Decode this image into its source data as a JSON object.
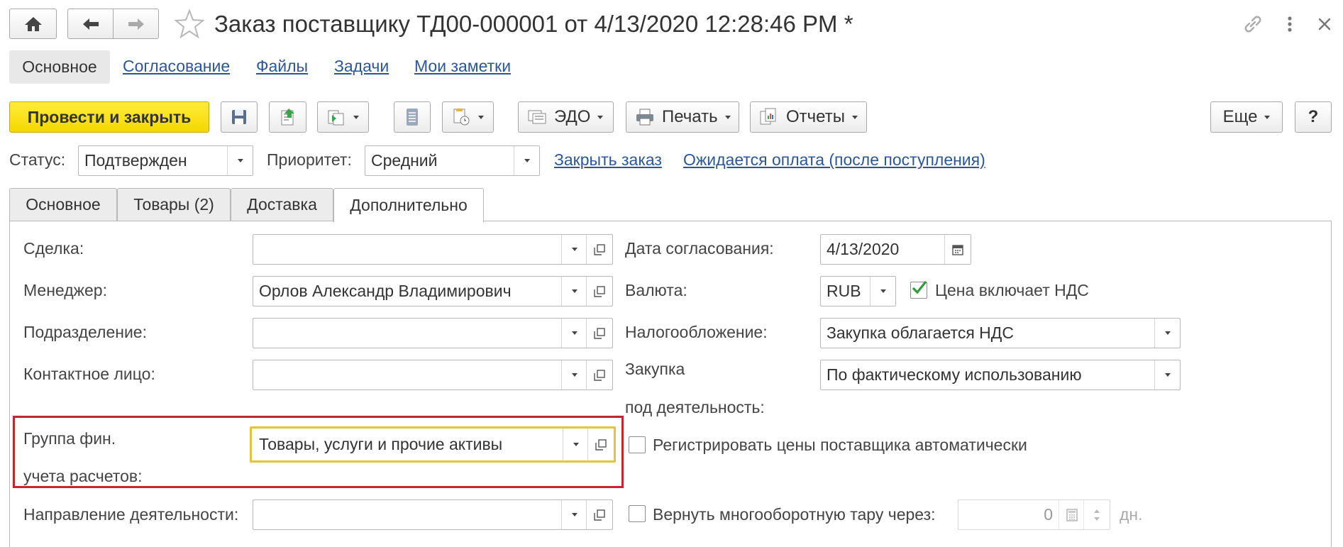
{
  "header": {
    "title": "Заказ поставщику ТД00-000001 от 4/13/2020 12:28:46 PM *"
  },
  "nav_tabs": [
    {
      "label": "Основное"
    },
    {
      "label": "Согласование"
    },
    {
      "label": "Файлы"
    },
    {
      "label": "Задачи"
    },
    {
      "label": "Мои заметки"
    }
  ],
  "toolbar": {
    "post_close": "Провести и закрыть",
    "edo": "ЭДО",
    "print": "Печать",
    "reports": "Отчеты",
    "more": "Еще",
    "help": "?"
  },
  "status_row": {
    "status_label": "Статус:",
    "status_value": "Подтвержден",
    "priority_label": "Приоритет:",
    "priority_value": "Средний",
    "close_order_link": "Закрыть заказ",
    "payment_link": "Ожидается оплата (после поступления)"
  },
  "form_tabs": [
    {
      "label": "Основное"
    },
    {
      "label": "Товары (2)"
    },
    {
      "label": "Доставка"
    },
    {
      "label": "Дополнительно"
    }
  ],
  "left_fields": {
    "deal_label": "Сделка:",
    "deal_value": "",
    "manager_label": "Менеджер:",
    "manager_value": "Орлов Александр Владимирович",
    "division_label": "Подразделение:",
    "division_value": "",
    "contact_label": "Контактное лицо:",
    "contact_value": "",
    "fin_group_label_1": "Группа фин.",
    "fin_group_label_2": "учета расчетов:",
    "fin_group_value": "Товары, услуги и прочие активы",
    "direction_label": "Направление деятельности:",
    "direction_value": ""
  },
  "right_fields": {
    "approval_date_label": "Дата согласования:",
    "approval_date_value": "4/13/2020",
    "currency_label": "Валюта:",
    "currency_value": "RUB",
    "vat_included_label": "Цена включает НДС",
    "vat_included_checked": true,
    "taxation_label": "Налогообложение:",
    "taxation_value": "Закупка облагается НДС",
    "purchase_label_1": "Закупка",
    "purchase_label_2": "под деятельность:",
    "purchase_value": "По фактическому использованию",
    "register_prices_label": "Регистрировать цены поставщика автоматически",
    "return_tare_label": "Вернуть многооборотную тару через:",
    "return_tare_value": "0",
    "return_tare_unit": "дн."
  },
  "colors": {
    "accent_yellow": "#f5d800",
    "highlight_red": "#c0282d",
    "focus_yellow": "#e6c33a",
    "link_blue": "#2b5797",
    "check_green": "#2e9a3c"
  }
}
